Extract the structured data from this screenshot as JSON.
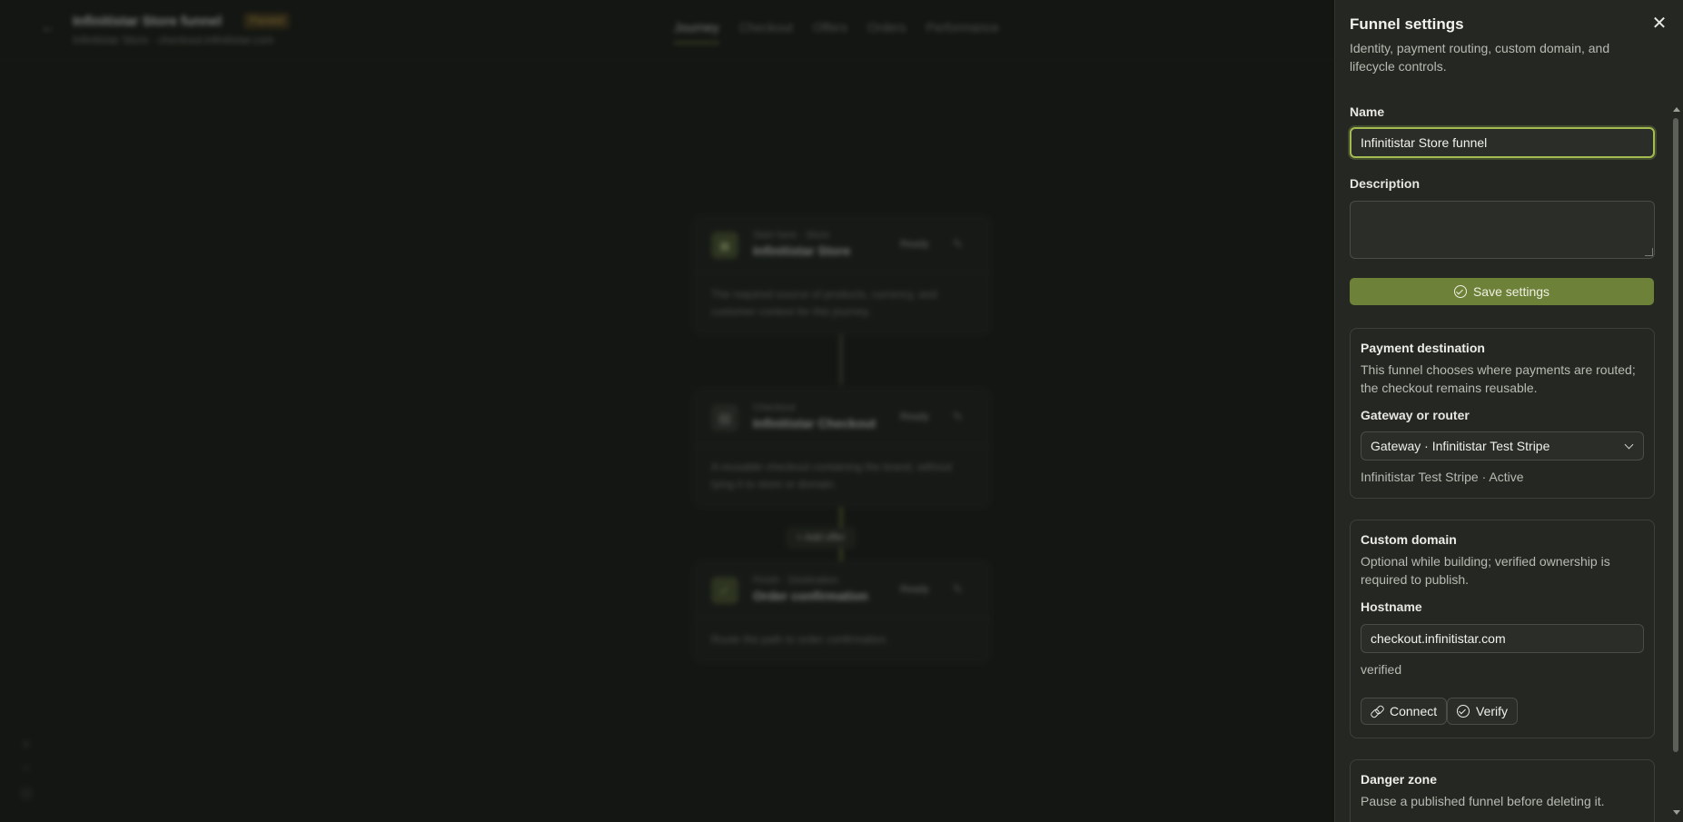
{
  "background": {
    "title": "Infinitistar Store funnel",
    "status": "Paused",
    "subtitle": "Infinitistar Store · checkout.infinitistar.com",
    "tabs": [
      {
        "label": "Journey",
        "active": true
      },
      {
        "label": "Checkout",
        "active": false
      },
      {
        "label": "Offers",
        "active": false
      },
      {
        "label": "Orders",
        "active": false
      },
      {
        "label": "Performance",
        "active": false
      }
    ],
    "cards": [
      {
        "kicker": "Start here · Store",
        "name": "Infinitistar Store",
        "ready": "Ready",
        "body": "The required source of products, currency, and customer context for this journey."
      },
      {
        "kicker": "Checkout",
        "name": "Infinitistar Checkout",
        "ready": "Ready",
        "body": "A reusable checkout containing the brand, without tying it to store or domain."
      },
      {
        "kicker": "Finish · Destination",
        "name": "Order confirmation",
        "ready": "Ready",
        "body": "Route the path to order confirmation."
      }
    ],
    "add_offer": "+ Add offer"
  },
  "panel": {
    "title": "Funnel settings",
    "description": "Identity, payment routing, custom domain, and lifecycle controls.",
    "name_label": "Name",
    "name_value": "Infinitistar Store funnel",
    "description_label": "Description",
    "description_value": "",
    "save_label": "Save settings",
    "payment": {
      "title": "Payment destination",
      "text": "This funnel chooses where payments are routed; the checkout remains reusable.",
      "gateway_label": "Gateway or router",
      "gateway_value": "Gateway · Infinitistar Test Stripe",
      "status": "Infinitistar Test Stripe · Active"
    },
    "domain": {
      "title": "Custom domain",
      "text": "Optional while building; verified ownership is required to publish.",
      "hostname_label": "Hostname",
      "hostname_value": "checkout.infinitistar.com",
      "status": "verified",
      "connect_label": "Connect",
      "verify_label": "Verify"
    },
    "danger": {
      "title": "Danger zone",
      "text": "Pause a published funnel before deleting it."
    }
  },
  "colors": {
    "accent": "#a4bb52",
    "primary_button": "#6e8138",
    "panel_bg": "#252723",
    "page_bg": "#1b1d1a"
  }
}
